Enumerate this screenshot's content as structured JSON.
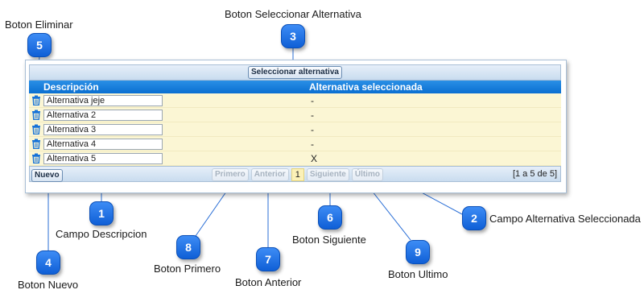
{
  "callouts": {
    "c1": {
      "num": "1",
      "label": "Campo Descripcion"
    },
    "c2": {
      "num": "2",
      "label": "Campo Alternativa Seleccionada"
    },
    "c3": {
      "num": "3",
      "label": "Boton Seleccionar Alternativa"
    },
    "c4": {
      "num": "4",
      "label": "Boton Nuevo"
    },
    "c5": {
      "num": "5",
      "label": "Boton Eliminar"
    },
    "c6": {
      "num": "6",
      "label": "Boton Siguiente"
    },
    "c7": {
      "num": "7",
      "label": "Boton Anterior"
    },
    "c8": {
      "num": "8",
      "label": "Boton Primero"
    },
    "c9": {
      "num": "9",
      "label": "Boton Ultimo"
    }
  },
  "toolbar": {
    "select_label": "Seleccionar alternativa"
  },
  "table": {
    "columns": [
      "Descripción",
      "Alternativa seleccionada"
    ],
    "rows": [
      {
        "description": "Alternativa jeje",
        "selected": "-"
      },
      {
        "description": "Alternativa 2",
        "selected": "-"
      },
      {
        "description": "Alternativa 3",
        "selected": "-"
      },
      {
        "description": "Alternativa 4",
        "selected": "-"
      },
      {
        "description": "Alternativa 5",
        "selected": "X"
      }
    ]
  },
  "footer": {
    "new_label": "Nuevo",
    "first_label": "Primero",
    "prev_label": "Anterior",
    "current_page": "1",
    "next_label": "Siguiente",
    "last_label": "Último",
    "range_text": "[1 a 5 de 5]"
  },
  "icons": {
    "delete": "trash-icon"
  },
  "colors": {
    "badge": "#1a6fe0",
    "header": "#0a6fd1",
    "row_bg": "#fbf6d4"
  }
}
